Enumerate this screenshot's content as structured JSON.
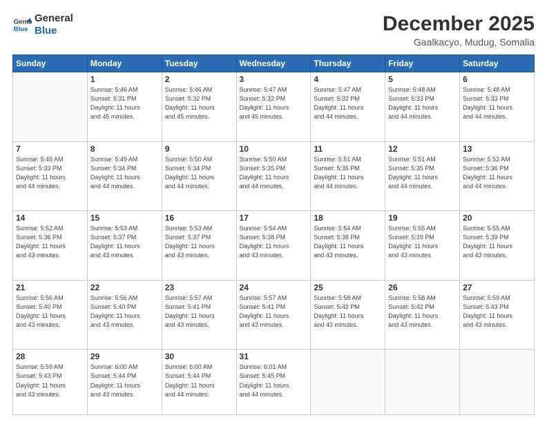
{
  "header": {
    "logo_line1": "General",
    "logo_line2": "Blue",
    "title": "December 2025",
    "subtitle": "Gaalkacyo, Mudug, Somalia"
  },
  "weekdays": [
    "Sunday",
    "Monday",
    "Tuesday",
    "Wednesday",
    "Thursday",
    "Friday",
    "Saturday"
  ],
  "weeks": [
    [
      {
        "day": "",
        "info": ""
      },
      {
        "day": "1",
        "info": "Sunrise: 5:46 AM\nSunset: 5:31 PM\nDaylight: 11 hours\nand 45 minutes."
      },
      {
        "day": "2",
        "info": "Sunrise: 5:46 AM\nSunset: 5:32 PM\nDaylight: 11 hours\nand 45 minutes."
      },
      {
        "day": "3",
        "info": "Sunrise: 5:47 AM\nSunset: 5:32 PM\nDaylight: 11 hours\nand 45 minutes."
      },
      {
        "day": "4",
        "info": "Sunrise: 5:47 AM\nSunset: 5:32 PM\nDaylight: 11 hours\nand 44 minutes."
      },
      {
        "day": "5",
        "info": "Sunrise: 5:48 AM\nSunset: 5:33 PM\nDaylight: 11 hours\nand 44 minutes."
      },
      {
        "day": "6",
        "info": "Sunrise: 5:48 AM\nSunset: 5:33 PM\nDaylight: 11 hours\nand 44 minutes."
      }
    ],
    [
      {
        "day": "7",
        "info": "Sunrise: 5:49 AM\nSunset: 5:33 PM\nDaylight: 11 hours\nand 44 minutes."
      },
      {
        "day": "8",
        "info": "Sunrise: 5:49 AM\nSunset: 5:34 PM\nDaylight: 11 hours\nand 44 minutes."
      },
      {
        "day": "9",
        "info": "Sunrise: 5:50 AM\nSunset: 5:34 PM\nDaylight: 11 hours\nand 44 minutes."
      },
      {
        "day": "10",
        "info": "Sunrise: 5:50 AM\nSunset: 5:35 PM\nDaylight: 11 hours\nand 44 minutes."
      },
      {
        "day": "11",
        "info": "Sunrise: 5:51 AM\nSunset: 5:35 PM\nDaylight: 11 hours\nand 44 minutes."
      },
      {
        "day": "12",
        "info": "Sunrise: 5:51 AM\nSunset: 5:35 PM\nDaylight: 11 hours\nand 44 minutes."
      },
      {
        "day": "13",
        "info": "Sunrise: 5:52 AM\nSunset: 5:36 PM\nDaylight: 11 hours\nand 44 minutes."
      }
    ],
    [
      {
        "day": "14",
        "info": "Sunrise: 5:52 AM\nSunset: 5:36 PM\nDaylight: 11 hours\nand 43 minutes."
      },
      {
        "day": "15",
        "info": "Sunrise: 5:53 AM\nSunset: 5:37 PM\nDaylight: 11 hours\nand 43 minutes."
      },
      {
        "day": "16",
        "info": "Sunrise: 5:53 AM\nSunset: 5:37 PM\nDaylight: 11 hours\nand 43 minutes."
      },
      {
        "day": "17",
        "info": "Sunrise: 5:54 AM\nSunset: 5:38 PM\nDaylight: 11 hours\nand 43 minutes."
      },
      {
        "day": "18",
        "info": "Sunrise: 5:54 AM\nSunset: 5:38 PM\nDaylight: 11 hours\nand 43 minutes."
      },
      {
        "day": "19",
        "info": "Sunrise: 5:55 AM\nSunset: 5:39 PM\nDaylight: 11 hours\nand 43 minutes."
      },
      {
        "day": "20",
        "info": "Sunrise: 5:55 AM\nSunset: 5:39 PM\nDaylight: 11 hours\nand 43 minutes."
      }
    ],
    [
      {
        "day": "21",
        "info": "Sunrise: 5:56 AM\nSunset: 5:40 PM\nDaylight: 11 hours\nand 43 minutes."
      },
      {
        "day": "22",
        "info": "Sunrise: 5:56 AM\nSunset: 5:40 PM\nDaylight: 11 hours\nand 43 minutes."
      },
      {
        "day": "23",
        "info": "Sunrise: 5:57 AM\nSunset: 5:41 PM\nDaylight: 11 hours\nand 43 minutes."
      },
      {
        "day": "24",
        "info": "Sunrise: 5:57 AM\nSunset: 5:41 PM\nDaylight: 11 hours\nand 43 minutes."
      },
      {
        "day": "25",
        "info": "Sunrise: 5:58 AM\nSunset: 5:42 PM\nDaylight: 11 hours\nand 43 minutes."
      },
      {
        "day": "26",
        "info": "Sunrise: 5:58 AM\nSunset: 5:42 PM\nDaylight: 11 hours\nand 43 minutes."
      },
      {
        "day": "27",
        "info": "Sunrise: 5:59 AM\nSunset: 5:43 PM\nDaylight: 11 hours\nand 43 minutes."
      }
    ],
    [
      {
        "day": "28",
        "info": "Sunrise: 5:59 AM\nSunset: 5:43 PM\nDaylight: 11 hours\nand 43 minutes."
      },
      {
        "day": "29",
        "info": "Sunrise: 6:00 AM\nSunset: 5:44 PM\nDaylight: 11 hours\nand 43 minutes."
      },
      {
        "day": "30",
        "info": "Sunrise: 6:00 AM\nSunset: 5:44 PM\nDaylight: 11 hours\nand 44 minutes."
      },
      {
        "day": "31",
        "info": "Sunrise: 6:01 AM\nSunset: 5:45 PM\nDaylight: 11 hours\nand 44 minutes."
      },
      {
        "day": "",
        "info": ""
      },
      {
        "day": "",
        "info": ""
      },
      {
        "day": "",
        "info": ""
      }
    ]
  ]
}
